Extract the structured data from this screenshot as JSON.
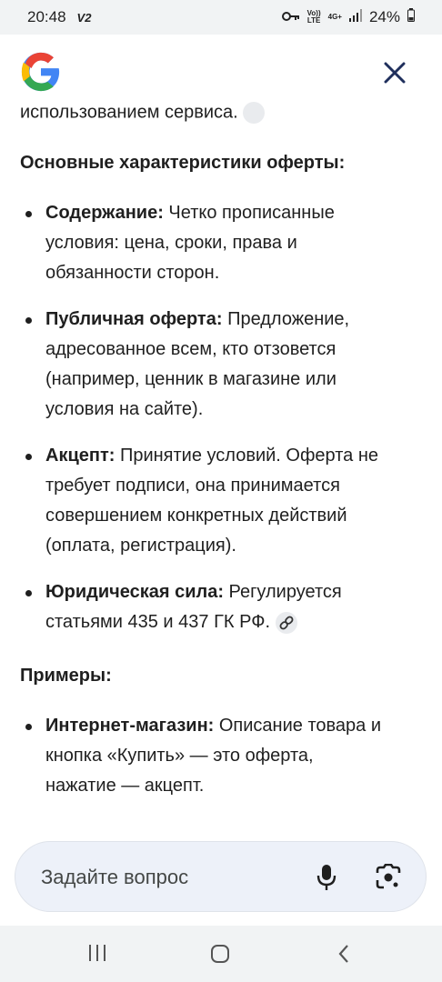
{
  "status": {
    "time": "20:48",
    "carrier": "V2",
    "volte_top": "Vo))",
    "volte_bottom": "LTE",
    "net_type": "4G+",
    "battery": "24%"
  },
  "content": {
    "cut_line": "использованием сервиса.",
    "section1_title": "Основные характеристики оферты:",
    "items1": [
      {
        "bold": "Содержание:",
        "line1_rest": " Четко прописанные",
        "line2": "условия: цена, сроки, права и",
        "line3": "обязанности сторон."
      },
      {
        "bold": "Публичная оферта:",
        "line1_rest": " Предложение,",
        "line2": "адресованное всем, кто отзовется",
        "line3": "(например, ценник в магазине или",
        "line4": "условия на сайте)."
      },
      {
        "bold": "Акцепт:",
        "line1_rest": " Принятие условий. Оферта не",
        "line2": "требует подписи, она принимается",
        "line3": "совершением конкретных действий",
        "line4": "(оплата, регистрация)."
      },
      {
        "bold": "Юридическая сила:",
        "line1_rest": " Регулируется",
        "line2": "статьями 435 и 437 ГК РФ."
      }
    ],
    "section2_title": "Примеры:",
    "items2": [
      {
        "bold": "Интернет-магазин:",
        "line1_rest": " Описание товара и",
        "line2": "кнопка «Купить» — это оферта,",
        "line3": "нажатие — акцепт."
      }
    ]
  },
  "ask": {
    "placeholder": "Задайте вопрос"
  },
  "icons": {
    "logo": "google-g-logo",
    "close": "close-icon",
    "link": "link-icon",
    "mic": "mic-icon",
    "lens": "google-lens-icon",
    "nav_recents": "recents-icon",
    "nav_home": "home-icon",
    "nav_back": "back-icon"
  },
  "colors": {
    "g_blue": "#4285F4",
    "g_red": "#EA4335",
    "g_yellow": "#FBBC05",
    "g_green": "#34A853",
    "ask_bg": "#edf1f9",
    "text": "#1f1f1f"
  }
}
